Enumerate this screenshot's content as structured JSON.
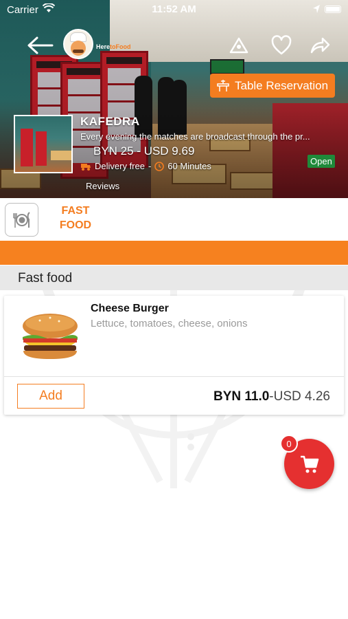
{
  "status_bar": {
    "carrier": "Carrier",
    "time": "11:52 AM"
  },
  "header": {
    "brand_text": "Here",
    "brand_accent": "toFood",
    "reservation_label": "Table Reservation"
  },
  "restaurant": {
    "name": "KAFEDRA",
    "description": "Every evening the matches are broadcast through the pr...",
    "price": "BYN 25 - USD 9.69",
    "delivery_label": "Delivery free",
    "delivery_sep": "-",
    "delivery_time": "60 Minutes",
    "status": "Open",
    "reviews_label": "Reviews"
  },
  "categories": {
    "active_label": "FAST FOOD"
  },
  "section": {
    "title": "Fast food"
  },
  "items": [
    {
      "name": "Cheese Burger",
      "description": "Lettuce, tomatoes, cheese, onions",
      "add_label": "Add",
      "price_byn": "BYN 11.0",
      "price_usd": "-USD 4.26"
    }
  ],
  "cart": {
    "count": "0"
  },
  "colors": {
    "accent": "#f47d20",
    "cart": "#e53030",
    "open": "#1f8a3a"
  }
}
